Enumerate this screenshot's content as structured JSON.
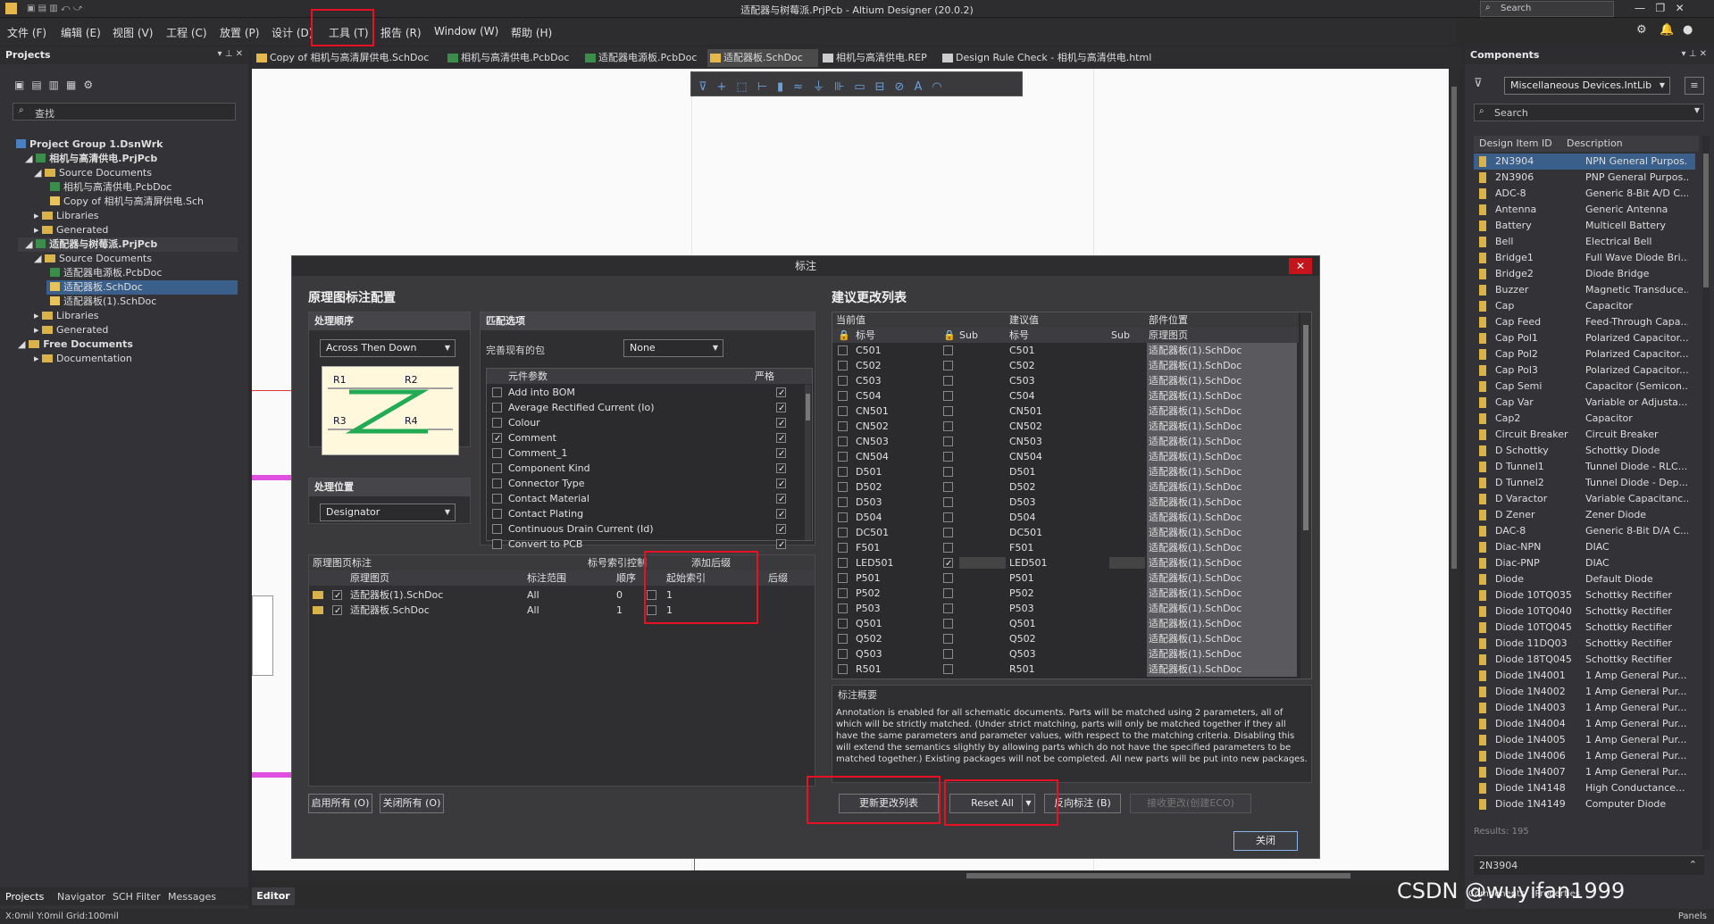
{
  "title": "适配器与树莓派.PrjPcb - Altium Designer (20.0.2)",
  "search_top": "Search",
  "menu": [
    "文件 (F)",
    "编辑 (E)",
    "视图 (V)",
    "工程 (C)",
    "放置 (P)",
    "设计 (D)",
    "工具 (T)",
    "报告 (R)",
    "Window (W)",
    "帮助 (H)"
  ],
  "tabs": [
    "Copy of 相机与高清屏供电.SchDoc",
    "相机与高清供电.PcbDoc",
    "适配器电源板.PcbDoc",
    "适配器板.SchDoc",
    "相机与高清供电.REP",
    "Design Rule Check - 相机与高清供电.html"
  ],
  "projects": {
    "header": "Projects",
    "search": "查找",
    "tree": [
      "Project Group 1.DsnWrk",
      "相机与高清供电.PrjPcb",
      "Source Documents",
      "相机与高清供电.PcbDoc",
      "Copy of 相机与高清屏供电.Sch",
      "Libraries",
      "Generated",
      "适配器与树莓派.PrjPcb",
      "Source Documents",
      "适配器电源板.PcbDoc",
      "适配器板.SchDoc",
      "适配器板(1).SchDoc",
      "Libraries",
      "Generated",
      "Free Documents",
      "Documentation"
    ],
    "bottom_tabs": [
      "Projects",
      "Navigator",
      "SCH Filter",
      "Messages"
    ]
  },
  "editor_tab": "Editor",
  "status": "X:0mil Y:0mil    Grid:100mil",
  "dialog": {
    "title": "标注",
    "close": "✕",
    "left_title": "原理图标注配置",
    "order_hdr": "处理顺序",
    "order_value": "Across Then Down",
    "diagram": {
      "r1": "R1",
      "r2": "R2",
      "r3": "R3",
      "r4": "R4"
    },
    "position_hdr": "处理位置",
    "position_value": "Designator",
    "match_hdr": "匹配选项",
    "complete_label": "完善现有的包",
    "complete_value": "None",
    "params_col1": "元件参数",
    "params_col2": "严格",
    "params": [
      {
        "name": "Add into BOM",
        "on": false
      },
      {
        "name": "Average Rectified Current (Io)",
        "on": false
      },
      {
        "name": "Colour",
        "on": false
      },
      {
        "name": "Comment",
        "on": true
      },
      {
        "name": "Comment_1",
        "on": false
      },
      {
        "name": "Component Kind",
        "on": false
      },
      {
        "name": "Connector Type",
        "on": false
      },
      {
        "name": "Contact Material",
        "on": false
      },
      {
        "name": "Contact Plating",
        "on": false
      },
      {
        "name": "Continuous Drain Current (Id)",
        "on": false
      },
      {
        "name": "Convert to PCB",
        "on": false
      }
    ],
    "sheets_hdr": "原理图页标注",
    "index_hdr": "标号索引控制",
    "suffix_hdr": "添加后缀",
    "sheet_cols": [
      "原理图页",
      "标注范围",
      "顺序",
      "起始索引",
      "后缀"
    ],
    "sheets": [
      {
        "name": "适配器板(1).SchDoc",
        "scope": "All",
        "order": "0",
        "start": "1"
      },
      {
        "name": "适配器板.SchDoc",
        "scope": "All",
        "order": "1",
        "start": "1"
      }
    ],
    "enable_all": "启用所有 (O)",
    "disable_all": "关闭所有 (O)",
    "right_title": "建议更改列表",
    "cur_hdr": "当前值",
    "prop_hdr": "建议值",
    "loc_hdr": "部件位置",
    "cols": [
      "标号",
      "Sub",
      "标号",
      "Sub",
      "原理图页"
    ],
    "changes": [
      {
        "cur": "C501",
        "prop": "C501",
        "sheet": "适配器板(1).SchDoc",
        "lock": false
      },
      {
        "cur": "C502",
        "prop": "C502",
        "sheet": "适配器板(1).SchDoc",
        "lock": false
      },
      {
        "cur": "C503",
        "prop": "C503",
        "sheet": "适配器板(1).SchDoc",
        "lock": false
      },
      {
        "cur": "C504",
        "prop": "C504",
        "sheet": "适配器板(1).SchDoc",
        "lock": false
      },
      {
        "cur": "CN501",
        "prop": "CN501",
        "sheet": "适配器板(1).SchDoc",
        "lock": false
      },
      {
        "cur": "CN502",
        "prop": "CN502",
        "sheet": "适配器板(1).SchDoc",
        "lock": false
      },
      {
        "cur": "CN503",
        "prop": "CN503",
        "sheet": "适配器板(1).SchDoc",
        "lock": false
      },
      {
        "cur": "CN504",
        "prop": "CN504",
        "sheet": "适配器板(1).SchDoc",
        "lock": false
      },
      {
        "cur": "D501",
        "prop": "D501",
        "sheet": "适配器板(1).SchDoc",
        "lock": false
      },
      {
        "cur": "D502",
        "prop": "D502",
        "sheet": "适配器板(1).SchDoc",
        "lock": false
      },
      {
        "cur": "D503",
        "prop": "D503",
        "sheet": "适配器板(1).SchDoc",
        "lock": false
      },
      {
        "cur": "D504",
        "prop": "D504",
        "sheet": "适配器板(1).SchDoc",
        "lock": false
      },
      {
        "cur": "DC501",
        "prop": "DC501",
        "sheet": "适配器板(1).SchDoc",
        "lock": false
      },
      {
        "cur": "F501",
        "prop": "F501",
        "sheet": "适配器板(1).SchDoc",
        "lock": false
      },
      {
        "cur": "LED501",
        "prop": "LED501",
        "sheet": "适配器板(1).SchDoc",
        "lock": true
      },
      {
        "cur": "P501",
        "prop": "P501",
        "sheet": "适配器板(1).SchDoc",
        "lock": false
      },
      {
        "cur": "P502",
        "prop": "P502",
        "sheet": "适配器板(1).SchDoc",
        "lock": false
      },
      {
        "cur": "P503",
        "prop": "P503",
        "sheet": "适配器板(1).SchDoc",
        "lock": false
      },
      {
        "cur": "Q501",
        "prop": "Q501",
        "sheet": "适配器板(1).SchDoc",
        "lock": false
      },
      {
        "cur": "Q502",
        "prop": "Q502",
        "sheet": "适配器板(1).SchDoc",
        "lock": false
      },
      {
        "cur": "Q503",
        "prop": "Q503",
        "sheet": "适配器板(1).SchDoc",
        "lock": false
      },
      {
        "cur": "R501",
        "prop": "R501",
        "sheet": "适配器板(1).SchDoc",
        "lock": false
      }
    ],
    "summary_hdr": "标注概要",
    "summary": "Annotation is enabled for all schematic documents. Parts will be matched using 2 parameters, all of which will be strictly matched. (Under strict matching, parts will only be matched together if they all have the same parameters and parameter values, with respect to the matching criteria. Disabling this will extend the semantics slightly by allowing parts which do not have the specified parameters to be matched together.) Existing packages will not be completed. All new parts will be put into new packages.",
    "update_btn": "更新更改列表",
    "reset_btn": "Reset All",
    "back_btn": "反向标注 (B)",
    "accept_btn": "接收更改(创建ECO)",
    "close_btn": "关闭"
  },
  "components": {
    "header": "Components",
    "library": "Miscellaneous Devices.IntLib",
    "search": "Search",
    "col_id": "Design Item ID",
    "col_desc": "Description",
    "items": [
      {
        "id": "2N3904",
        "desc": "NPN General Purpos..."
      },
      {
        "id": "2N3906",
        "desc": "PNP General Purpos..."
      },
      {
        "id": "ADC-8",
        "desc": "Generic 8-Bit A/D C..."
      },
      {
        "id": "Antenna",
        "desc": "Generic Antenna"
      },
      {
        "id": "Battery",
        "desc": "Multicell Battery"
      },
      {
        "id": "Bell",
        "desc": "Electrical Bell"
      },
      {
        "id": "Bridge1",
        "desc": "Full Wave Diode Bri..."
      },
      {
        "id": "Bridge2",
        "desc": "Diode Bridge"
      },
      {
        "id": "Buzzer",
        "desc": "Magnetic Transduce..."
      },
      {
        "id": "Cap",
        "desc": "Capacitor"
      },
      {
        "id": "Cap Feed",
        "desc": "Feed-Through Capa..."
      },
      {
        "id": "Cap Pol1",
        "desc": "Polarized Capacitor..."
      },
      {
        "id": "Cap Pol2",
        "desc": "Polarized Capacitor..."
      },
      {
        "id": "Cap Pol3",
        "desc": "Polarized Capacitor..."
      },
      {
        "id": "Cap Semi",
        "desc": "Capacitor (Semicon..."
      },
      {
        "id": "Cap Var",
        "desc": "Variable or Adjusta..."
      },
      {
        "id": "Cap2",
        "desc": "Capacitor"
      },
      {
        "id": "Circuit Breaker",
        "desc": "Circuit Breaker"
      },
      {
        "id": "D Schottky",
        "desc": "Schottky Diode"
      },
      {
        "id": "D Tunnel1",
        "desc": "Tunnel Diode - RLC..."
      },
      {
        "id": "D Tunnel2",
        "desc": "Tunnel Diode - Dep..."
      },
      {
        "id": "D Varactor",
        "desc": "Variable Capacitanc..."
      },
      {
        "id": "D Zener",
        "desc": "Zener Diode"
      },
      {
        "id": "DAC-8",
        "desc": "Generic 8-Bit D/A C..."
      },
      {
        "id": "Diac-NPN",
        "desc": "DIAC"
      },
      {
        "id": "Diac-PNP",
        "desc": "DIAC"
      },
      {
        "id": "Diode",
        "desc": "Default Diode"
      },
      {
        "id": "Diode 10TQ035",
        "desc": "Schottky Rectifier"
      },
      {
        "id": "Diode 10TQ040",
        "desc": "Schottky Rectifier"
      },
      {
        "id": "Diode 10TQ045",
        "desc": "Schottky Rectifier"
      },
      {
        "id": "Diode 11DQ03",
        "desc": "Schottky Rectifier"
      },
      {
        "id": "Diode 18TQ045",
        "desc": "Schottky Rectifier"
      },
      {
        "id": "Diode 1N4001",
        "desc": "1 Amp General Pur..."
      },
      {
        "id": "Diode 1N4002",
        "desc": "1 Amp General Pur..."
      },
      {
        "id": "Diode 1N4003",
        "desc": "1 Amp General Pur..."
      },
      {
        "id": "Diode 1N4004",
        "desc": "1 Amp General Pur..."
      },
      {
        "id": "Diode 1N4005",
        "desc": "1 Amp General Pur..."
      },
      {
        "id": "Diode 1N4006",
        "desc": "1 Amp General Pur..."
      },
      {
        "id": "Diode 1N4007",
        "desc": "1 Amp General Pur..."
      },
      {
        "id": "Diode 1N4148",
        "desc": "High Conductance..."
      },
      {
        "id": "Diode 1N4149",
        "desc": "Computer Diode"
      }
    ],
    "results": "Results: 195",
    "selected": "2N3904",
    "bottom_tabs": [
      "Components",
      "Properties"
    ],
    "panels_btn": "Panels"
  },
  "watermark": "CSDN @wuyifan1999"
}
